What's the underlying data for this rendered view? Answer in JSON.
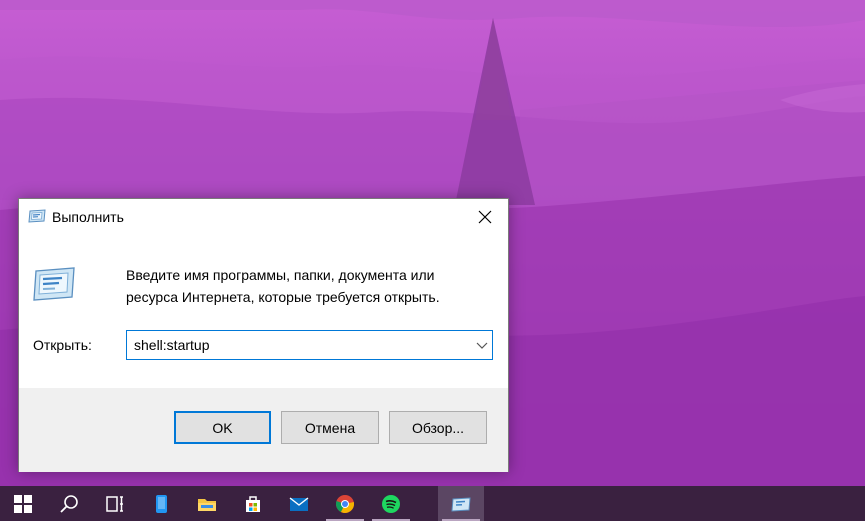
{
  "dialog": {
    "title": "Выполнить",
    "description": "Введите имя программы, папки, документа или ресурса Интернета, которые требуется открыть.",
    "open_label": "Открыть:",
    "input_value": "shell:startup",
    "buttons": {
      "ok": "OK",
      "cancel": "Отмена",
      "browse": "Обзор..."
    }
  },
  "taskbar": {
    "items": [
      "start-icon",
      "search-icon",
      "task-view-icon",
      "phone-icon",
      "file-explorer-icon",
      "store-icon",
      "mail-icon",
      "chrome-icon",
      "spotify-icon",
      "run-icon"
    ]
  },
  "colors": {
    "accent": "#0078d7",
    "wallpaper": "#a440b8",
    "taskbar": "#3a2140"
  }
}
